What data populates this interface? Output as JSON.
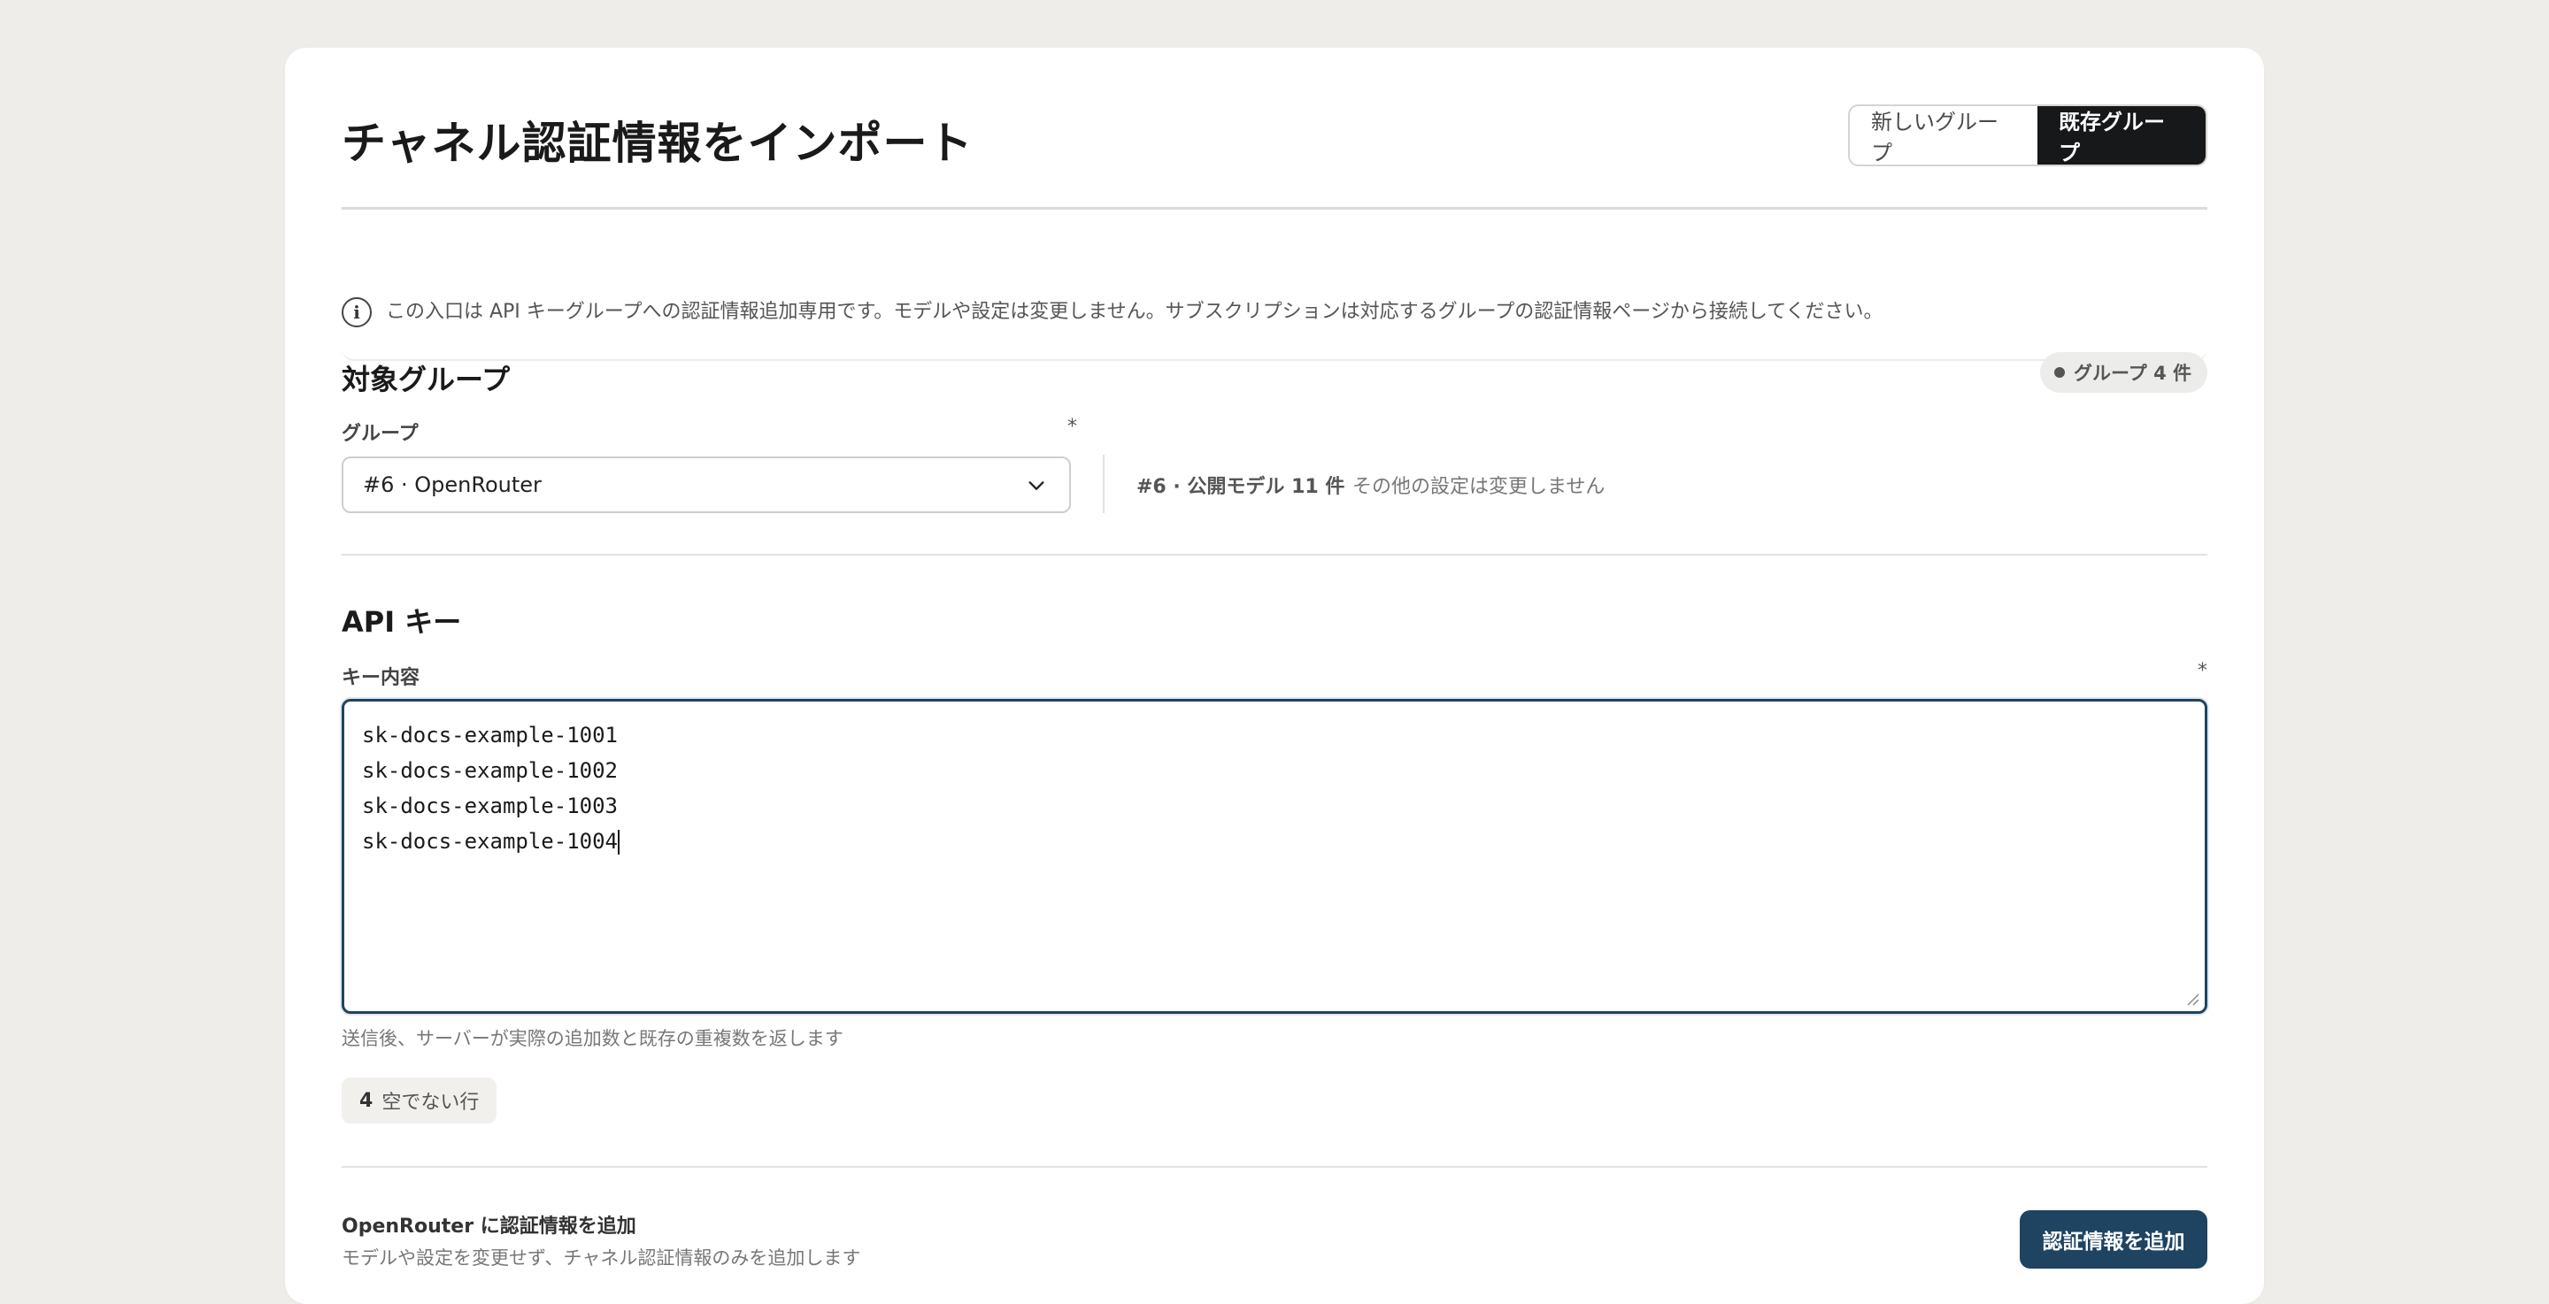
{
  "page": {
    "title": "チャネル認証情報をインポート"
  },
  "mode_toggle": {
    "new_group_label": "新しいグループ",
    "existing_group_label": "既存グループ",
    "selected": "existing_group"
  },
  "notice": {
    "icon": "info-icon",
    "text": "この入口は API キーグループへの認証情報追加専用です。モデルや設定は変更しません。サブスクリプションは対応するグループの認証情報ページから接続してください。"
  },
  "target_group": {
    "section_title": "対象グループ",
    "badge_label": "グループ 4 件",
    "field_label": "グループ",
    "required_mark": "*",
    "selected_value": "#6 · OpenRouter",
    "meta": "#6 · 公開モデル 11 件",
    "note": "その他の設定は変更しません"
  },
  "api_keys": {
    "section_title": "API キー",
    "field_label": "キー内容",
    "required_mark": "*",
    "lines": [
      "sk-docs-example-1001",
      "sk-docs-example-1002",
      "sk-docs-example-1003",
      "sk-docs-example-1004"
    ],
    "hint": "送信後、サーバーが実際の追加数と既存の重複数を返します",
    "line_count": "4",
    "line_count_label": "空でない行"
  },
  "footer": {
    "title": "OpenRouter に認証情報を追加",
    "subtitle": "モデルや設定を変更せず、チャネル認証情報のみを追加します",
    "submit_label": "認証情報を追加"
  },
  "colors": {
    "background": "#eeede9",
    "card": "#ffffff",
    "accent": "#1e4461",
    "toggle_active": "#16181a"
  }
}
